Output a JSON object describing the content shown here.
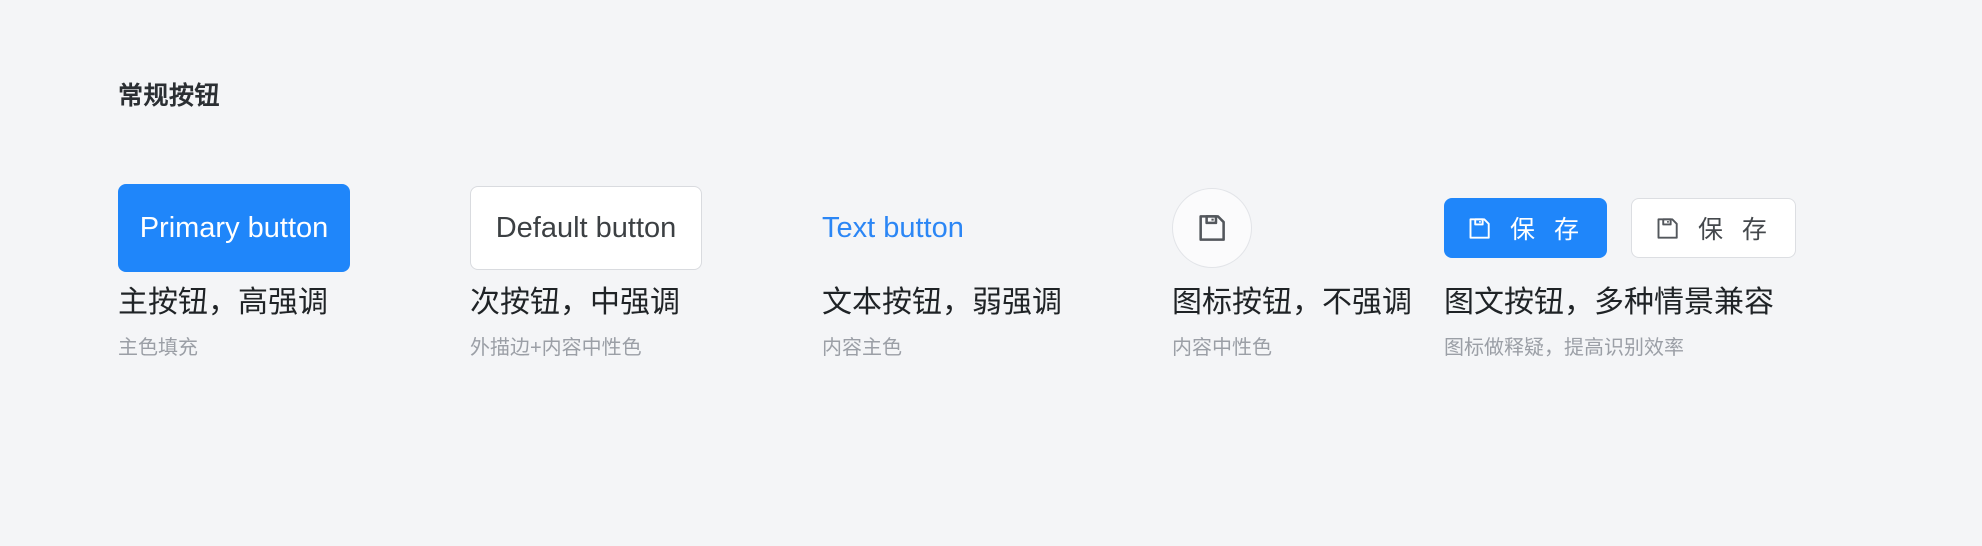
{
  "section": {
    "title": "常规按钮"
  },
  "colors": {
    "background": "#f4f5f7",
    "primary": "#1f86fa",
    "text_primary": "#1f2326",
    "text_secondary": "#9b9fa6",
    "border": "#d9dbdf",
    "surface": "#ffffff"
  },
  "columns": [
    {
      "id": "primary",
      "button_label": "Primary button",
      "caption_main": "主按钮，高强调",
      "caption_sub": "主色填充"
    },
    {
      "id": "default",
      "button_label": "Default button",
      "caption_main": "次按钮，中强调",
      "caption_sub": "外描边+内容中性色"
    },
    {
      "id": "text",
      "button_label": "Text button",
      "caption_main": "文本按钮，弱强调",
      "caption_sub": "内容主色"
    },
    {
      "id": "icon",
      "icon_name": "save-floppy-icon",
      "caption_main": "图标按钮，不强调",
      "caption_sub": "内容中性色"
    },
    {
      "id": "icon-text",
      "button_primary_label": "保 存",
      "button_default_label": "保 存",
      "icon_name": "save-floppy-icon",
      "caption_main": "图文按钮，多种情景兼容",
      "caption_sub": "图标做释疑，提高识别效率"
    }
  ]
}
